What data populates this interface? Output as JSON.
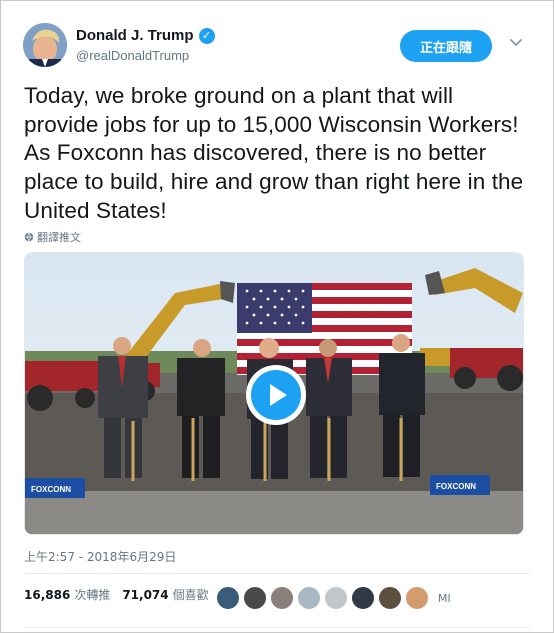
{
  "user": {
    "name": "Donald J. Trump",
    "handle": "@realDonaldTrump",
    "verified_icon": "verified-badge-icon"
  },
  "follow_button": {
    "label": "正在跟隨"
  },
  "tweet": {
    "text": "Today, we broke ground on a plant that will provide jobs for up to 15,000 Wisconsin Workers! As Foxconn has discovered, there is no better place to build, hire and grow than right here in the United States!",
    "translate_label": "翻譯推文"
  },
  "media": {
    "type": "video",
    "banner_left": "FOXCONN",
    "banner_right": "FOXCONN",
    "watermark": "",
    "play_icon": "play-icon"
  },
  "meta": {
    "timestamp": "上午2:57 - 2018年6月29日"
  },
  "stats": {
    "retweets_count": "16,886",
    "retweets_label": "次轉推",
    "likes_count": "71,074",
    "likes_label": "個喜歡",
    "more_likers": "MI"
  },
  "colors": {
    "accent": "#1da1f2",
    "text": "#14171a",
    "secondary": "#657786"
  }
}
